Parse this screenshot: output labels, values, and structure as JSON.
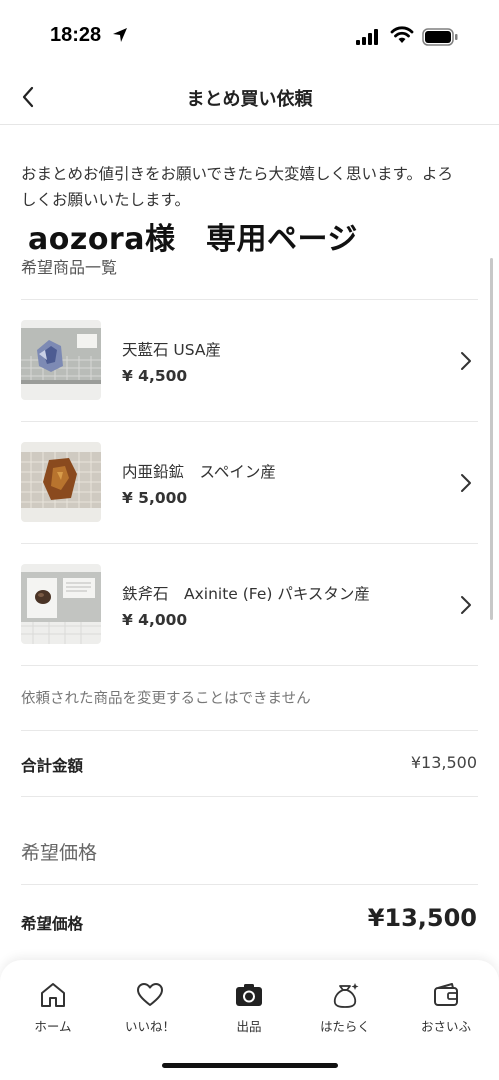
{
  "status_bar": {
    "time": "18:28"
  },
  "nav": {
    "title": "まとめ買い依頼"
  },
  "message": "おまとめお値引きをお願いできたら大変嬉しく思います。よろしくお願いいたします。",
  "heading": "aozora様　専用ページ",
  "list_title": "希望商品一覧",
  "items": [
    {
      "name": "天藍石 USA産",
      "price": "¥ 4,500"
    },
    {
      "name": "内亜鉛鉱　スペイン産",
      "price": "¥ 5,000"
    },
    {
      "name": "鉄斧石　Axinite (Fe) パキスタン産",
      "price": "¥ 4,000"
    }
  ],
  "note": "依頼された商品を変更することはできません",
  "total": {
    "label": "合計金額",
    "value": "¥13,500"
  },
  "desired_section_title": "希望価格",
  "desired": {
    "label": "希望価格",
    "value": "¥13,500"
  },
  "tabs": [
    {
      "label": "ホーム",
      "icon": "home-icon"
    },
    {
      "label": "いいね！",
      "icon": "heart-icon"
    },
    {
      "label": "出品",
      "icon": "camera-icon"
    },
    {
      "label": "はたらく",
      "icon": "money-bag-icon"
    },
    {
      "label": "おさいふ",
      "icon": "wallet-icon"
    }
  ]
}
